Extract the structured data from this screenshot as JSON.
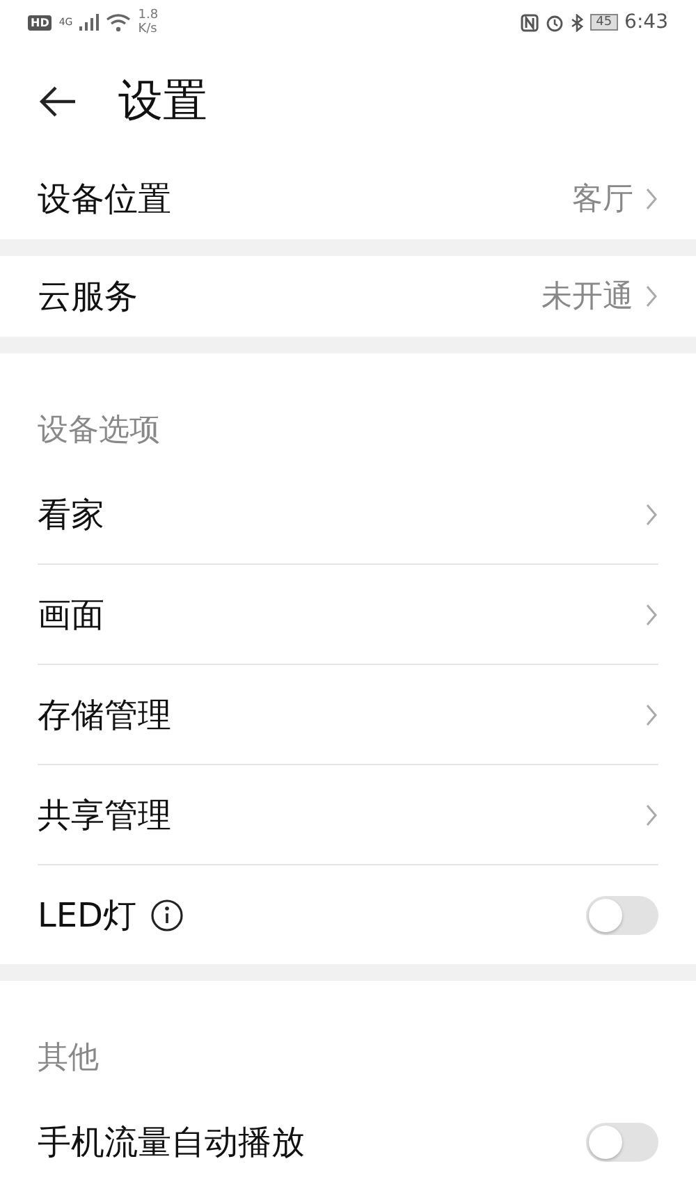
{
  "status_bar": {
    "hd": "HD",
    "network": "4G",
    "speed": "1.8 K/s",
    "battery": "45",
    "time": "6:43"
  },
  "header": {
    "title": "设置"
  },
  "sections": [
    {
      "items": [
        {
          "kind": "nav",
          "label": "设备位置",
          "value": "客厅"
        }
      ]
    },
    {
      "items": [
        {
          "kind": "nav",
          "label": "云服务",
          "value": "未开通"
        }
      ]
    },
    {
      "heading": "设备选项",
      "items": [
        {
          "kind": "nav",
          "label": "看家"
        },
        {
          "kind": "nav",
          "label": "画面"
        },
        {
          "kind": "nav",
          "label": "存储管理"
        },
        {
          "kind": "nav",
          "label": "共享管理"
        },
        {
          "kind": "toggle",
          "label": "LED灯",
          "info": true,
          "on": false
        }
      ]
    },
    {
      "heading": "其他",
      "items": [
        {
          "kind": "toggle",
          "label": "手机流量自动播放",
          "on": false
        }
      ]
    }
  ]
}
